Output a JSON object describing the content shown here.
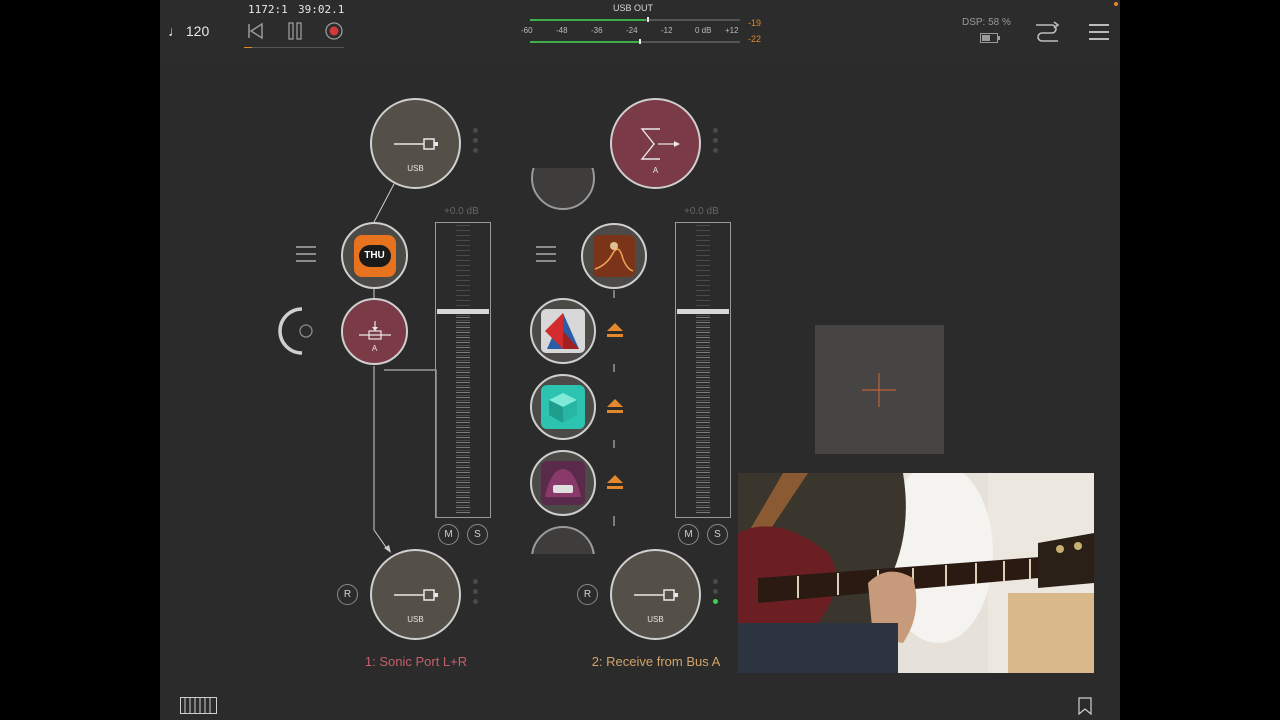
{
  "transport": {
    "tempo": "♩ 120",
    "bar_beat": "1172:1",
    "time": "39:02.1"
  },
  "meter": {
    "title": "USB OUT",
    "scale": [
      "-60",
      "-48",
      "-36",
      "-24",
      "-12",
      "0 dB",
      "+12"
    ],
    "peak_top": "-19",
    "peak_bottom": "-22"
  },
  "status": {
    "dsp": "DSP: 58 %"
  },
  "channel1": {
    "input_label": "USB",
    "fx_label": "A",
    "output_label": "USB",
    "fader_db": "+0.0 dB",
    "mute": "M",
    "solo": "S",
    "record": "R",
    "name": "1: Sonic Port L+R",
    "plugin_logo": "THU"
  },
  "channel2": {
    "input_label": "A",
    "output_label": "USB",
    "fader_db": "+0.0 dB",
    "mute": "M",
    "solo": "S",
    "record": "R",
    "name": "2: Receive from Bus A"
  },
  "colors": {
    "accent": "#e3882b",
    "node_red": "#7a3a46",
    "channel1_label": "#c4606c",
    "channel2_label": "#d2a36a"
  }
}
